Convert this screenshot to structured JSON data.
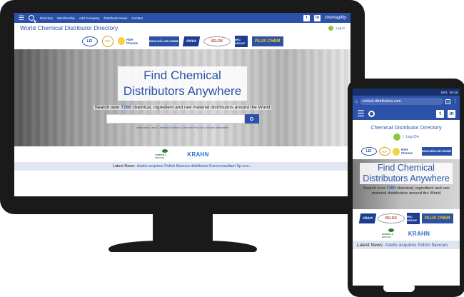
{
  "desktop": {
    "nav": {
      "links": [
        "Directory",
        "Membership",
        "Add Company",
        "Distributor News",
        "Contact"
      ],
      "social": [
        "t",
        "in"
      ],
      "brand": "chemagility"
    },
    "header": {
      "title": "World Chemical Distributor Directory",
      "login": "Log In"
    },
    "logos": [
      "LEI",
      "TCF",
      "HSH Chemie",
      "BODO MÖLLER CHEMIE",
      "ONVA",
      "VELOX",
      "NRC GROUP",
      "PLUS CHEM"
    ],
    "hero": {
      "title_line1": "Find Chemical",
      "title_line2": "Distributors Anywhere",
      "sub_prefix": "Search over",
      "count": "7280",
      "sub_suffix": "chemical, ingredient and raw material distributors around the World",
      "learn_more_prefix": "Learn more, I am a",
      "learn_more_links": "Chemical Distributor | Chemical Producer | Industry Stakeholder"
    },
    "sponsors": [
      "KEMPER & MACKAY",
      "KRAHN"
    ],
    "news": {
      "label": "Latest News:",
      "headline": "Azelis acquires Polish flavours distributor Euroconsultant Sp.zoo..."
    }
  },
  "phone": {
    "status": {
      "battery": "53%",
      "time": "09:18"
    },
    "url": "emical-distributors.com",
    "tab_count": "5",
    "social": [
      "t",
      "in"
    ],
    "title": "Chemical Distributor Directory",
    "login": "Log On",
    "logos_top": [
      "LEI",
      "TCF",
      "HSH Chemie",
      "BODO MÖLLER CHEMIE"
    ],
    "hero": {
      "title_line1": "Find Chemical",
      "title_line2": "Distributors Anywhere",
      "sub_prefix": "Search over",
      "count": "7280",
      "sub_suffix": "chemical, ingredient and raw material distributors around the World"
    },
    "logos_mid": [
      "ONVA",
      "VELOX",
      "NRC GROUP",
      "PLUS CHEM"
    ],
    "logos_bottom": [
      "KEMPER & MACKAY",
      "KRAHN"
    ],
    "news": {
      "label": "Latest News:",
      "headline": "Azelis acquires Polish flavours"
    }
  }
}
